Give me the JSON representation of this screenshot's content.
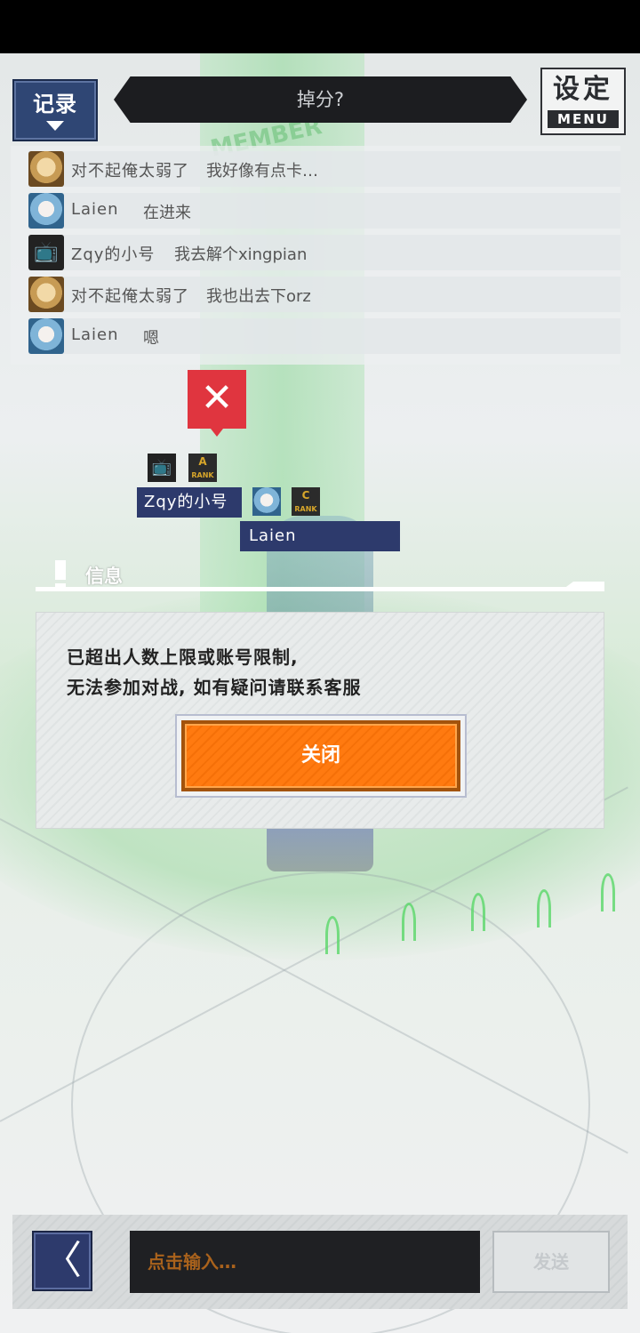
{
  "top_bar": {
    "log_label": "记录",
    "title": "掉分?",
    "menu_big": "设定",
    "menu_small": "MENU"
  },
  "chat_log": [
    {
      "avatar": "gold-hair-avatar",
      "name": "对不起俺太弱了",
      "message": "我好像有点卡…"
    },
    {
      "avatar": "blue-hair-avatar",
      "name": "Laien",
      "message": "在进来"
    },
    {
      "avatar": "tv-avatar",
      "name": "Zqy的小号",
      "message": "我去解个xingpian"
    },
    {
      "avatar": "gold-hair-avatar",
      "name": "对不起俺太弱了",
      "message": "我也出去下orz"
    },
    {
      "avatar": "blue-hair-avatar",
      "name": "Laien",
      "message": "嗯"
    }
  ],
  "scene": {
    "tower_text": "MEMBER",
    "player1_name": "Zqy的小号",
    "player2_name": "Laien",
    "rank1": "A",
    "rank2": "C",
    "rank_word": "RANK"
  },
  "dialog": {
    "title": "信息",
    "line1": "已超出人数上限或账号限制,",
    "line2": "无法参加对战, 如有疑问请联系客服",
    "close_label": "关闭"
  },
  "input_bar": {
    "back_glyph": "〈",
    "placeholder": "点击输入…",
    "send_label": "发送"
  }
}
